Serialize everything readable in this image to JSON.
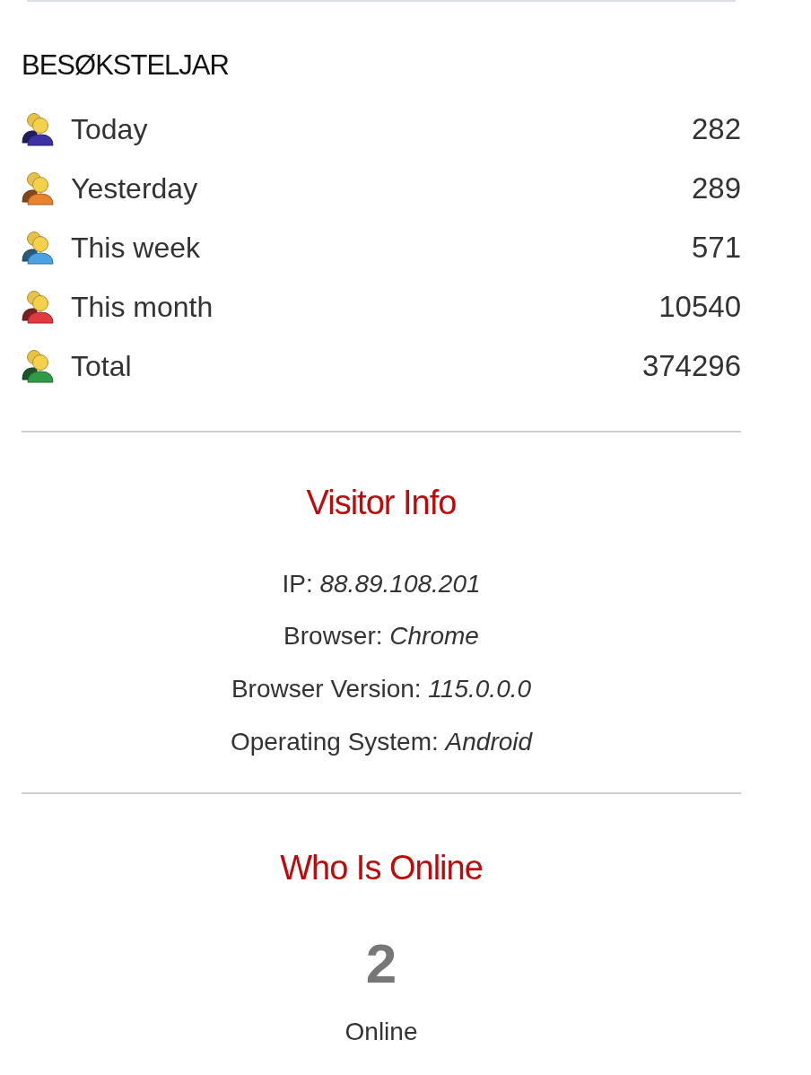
{
  "heading": "BESØKSTELJAR",
  "counters": [
    {
      "label": "Today",
      "value": "282",
      "color": "#3d31a6"
    },
    {
      "label": "Yesterday",
      "value": "289",
      "color": "#e8832f"
    },
    {
      "label": "This week",
      "value": "571",
      "color": "#4aa2e2"
    },
    {
      "label": "This month",
      "value": "10540",
      "color": "#e03a40"
    },
    {
      "label": "Total",
      "value": "374296",
      "color": "#2f9b48"
    }
  ],
  "visitor_info": {
    "title": "Visitor Info",
    "lines": [
      "IP: *88.89.108.201*",
      "Browser: *Chrome*",
      "Browser Version: *115.0.0.0*",
      "Operating System: *Android*"
    ]
  },
  "who_is_online": {
    "title": "Who Is Online",
    "count": "2",
    "label": "Online"
  }
}
